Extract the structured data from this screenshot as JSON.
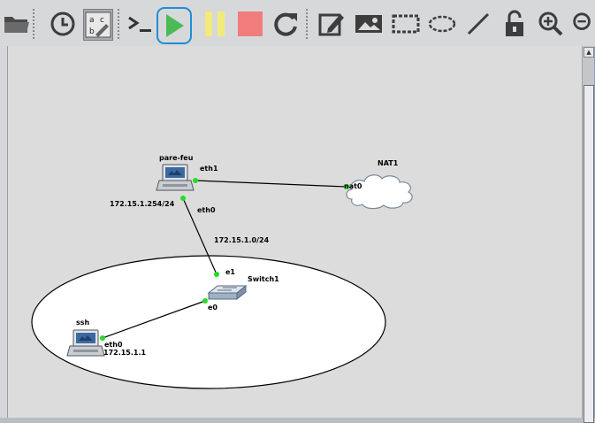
{
  "toolbar": {
    "buttons": [
      {
        "name": "open-folder-button",
        "icon": "folder-icon"
      },
      {
        "name": "history-button",
        "icon": "clock-icon"
      },
      {
        "name": "show-labels-button",
        "icon": "abc-label-icon"
      },
      {
        "name": "console-button",
        "icon": "terminal-prompt-icon",
        "text": ">_"
      },
      {
        "name": "start-all-button",
        "icon": "play-icon"
      },
      {
        "name": "suspend-all-button",
        "icon": "pause-icon"
      },
      {
        "name": "stop-all-button",
        "icon": "stop-icon"
      },
      {
        "name": "reload-all-button",
        "icon": "reload-icon"
      },
      {
        "name": "add-note-button",
        "icon": "edit-note-icon"
      },
      {
        "name": "insert-picture-button",
        "icon": "picture-icon"
      },
      {
        "name": "draw-rectangle-button",
        "icon": "rectangle-icon"
      },
      {
        "name": "draw-ellipse-button",
        "icon": "ellipse-icon"
      },
      {
        "name": "draw-line-button",
        "icon": "line-icon"
      },
      {
        "name": "lock-items-button",
        "icon": "unlock-icon"
      },
      {
        "name": "zoom-in-button",
        "icon": "zoom-in-icon"
      },
      {
        "name": "zoom-out-button",
        "icon": "zoom-out-icon"
      }
    ],
    "colors": {
      "play": "#4cbb57",
      "pause": "#f2ea7a",
      "stop": "#f07c7c",
      "highlight": "#1a8fd6"
    }
  },
  "topology": {
    "nodes": {
      "firewall": {
        "label": "pare-feu"
      },
      "nat": {
        "label": "NAT1"
      },
      "switch": {
        "label": "Switch1"
      },
      "ssh": {
        "label": "ssh"
      }
    },
    "ports": {
      "firewall_eth1": "eth1",
      "firewall_eth0": "eth0",
      "nat_nat0": "nat0",
      "switch_e1": "e1",
      "switch_e0": "e0",
      "ssh_eth0": "eth0"
    },
    "annotations": {
      "firewall_ip": "172.15.1.254/24",
      "subnet": "172.15.1.0/24",
      "ssh_ip": "172.15.1.1"
    },
    "link_status_color": "#22dd22"
  }
}
